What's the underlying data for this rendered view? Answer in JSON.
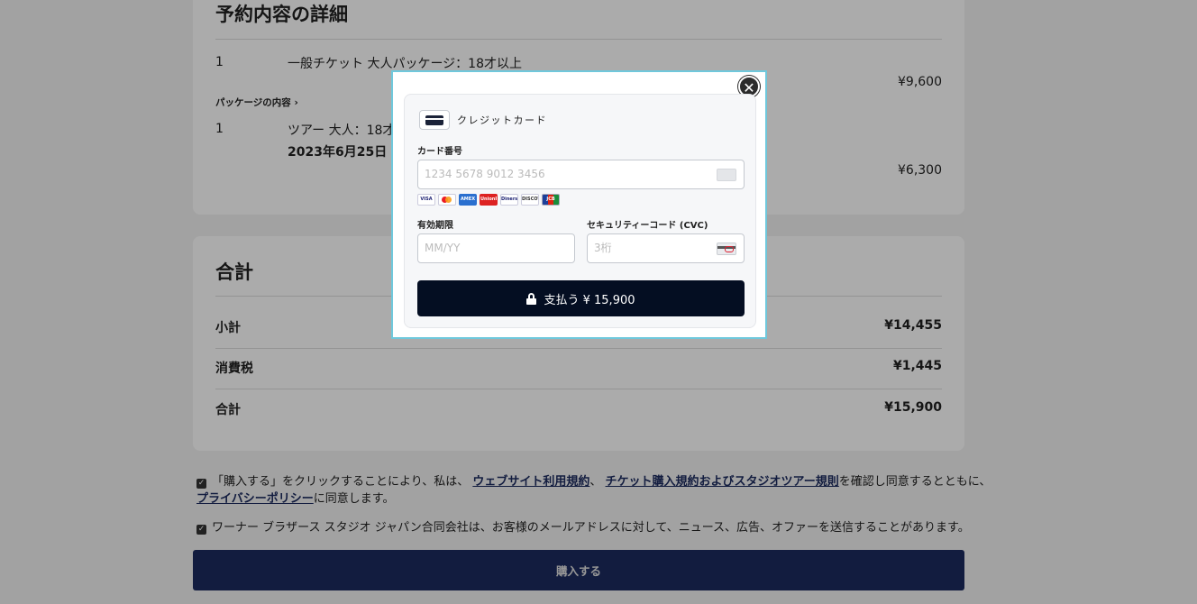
{
  "details": {
    "title": "予約内容の詳細",
    "item1": {
      "qty": "1",
      "name": "一般チケット 大人パッケージ：18才以上",
      "price": "¥9,600"
    },
    "package_link": "パッケージの内容 ›",
    "item2": {
      "qty": "1",
      "name": "ツアー 大人：18才以上",
      "date": "2023年6月25日 12:",
      "price": "¥6,300"
    }
  },
  "total": {
    "title": "合計",
    "rows": [
      {
        "label": "小計",
        "value": "¥14,455"
      },
      {
        "label": "消費税",
        "value": "¥1,445"
      },
      {
        "label": "合計",
        "value": "¥15,900"
      }
    ]
  },
  "consent": {
    "line1_pre": "「購入する」をクリックすることにより、私は、",
    "terms_link": "ウェブサイト利用規約",
    "sep": "、",
    "ticket_link": "チケット購入規約およびスタジオツアー規則",
    "line1_post": "を確認し同意するとともに、",
    "privacy_link": "プライバシーポリシー",
    "line2_post": "に同意します。",
    "marketing": "ワーナー ブラザース スタジオ ジャパン合同会社は、お客様のメールアドレスに対して、ニュース、広告、オファーを送信することがあります。"
  },
  "purchase_button": "購入する",
  "modal": {
    "method_label": "クレジットカード",
    "card_number_label": "カード番号",
    "card_number_placeholder": "1234 5678 9012 3456",
    "brands": [
      "VISA",
      "",
      "AMEX",
      "UnionPay",
      "Diners",
      "DISCOVER",
      "JCB"
    ],
    "expiry_label": "有効期限",
    "expiry_placeholder": "MM/YY",
    "cvc_label": "セキュリティーコード (CVC)",
    "cvc_placeholder": "3桁",
    "pay_button": "支払う ¥ 15,900",
    "close_symbol": "✕"
  }
}
